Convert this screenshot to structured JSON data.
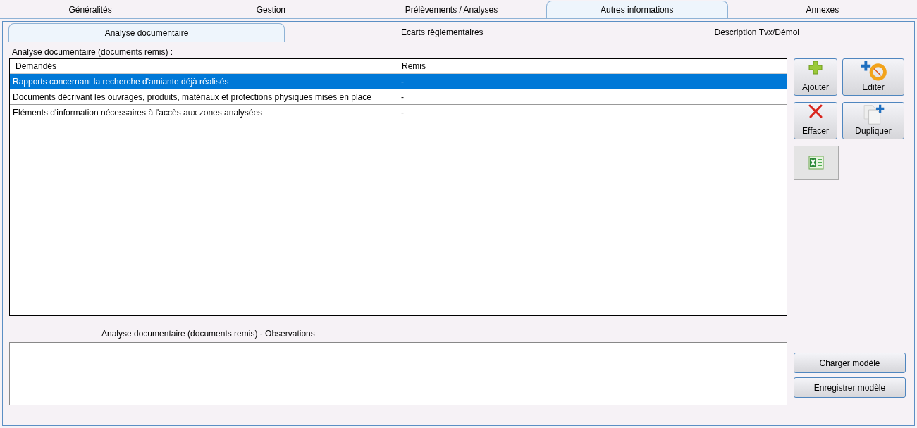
{
  "main_tabs": [
    {
      "label": "Généralités",
      "selected": false
    },
    {
      "label": "Gestion",
      "selected": false
    },
    {
      "label": "Prélèvements / Analyses",
      "selected": false
    },
    {
      "label": "Autres informations",
      "selected": true
    },
    {
      "label": "Annexes",
      "selected": false
    }
  ],
  "sub_tabs": [
    {
      "label": "Analyse documentaire",
      "selected": true
    },
    {
      "label": "Ecarts règlementaires",
      "selected": false
    },
    {
      "label": "Description Tvx/Démol",
      "selected": false
    }
  ],
  "table": {
    "title": "Analyse documentaire (documents remis) :",
    "columns": [
      "Demandés",
      "Remis"
    ],
    "rows": [
      {
        "cells": [
          "Rapports concernant la recherche d'amiante déjà réalisés",
          "-"
        ],
        "selected": true
      },
      {
        "cells": [
          "Documents décrivant les ouvrages, produits, matériaux et protections physiques mises en place",
          "-"
        ],
        "selected": false
      },
      {
        "cells": [
          "Eléments d'information nécessaires à l'accès aux zones analysées",
          "-"
        ],
        "selected": false
      }
    ]
  },
  "actions": [
    {
      "kind": "add",
      "label": "Ajouter"
    },
    {
      "kind": "edit",
      "label": "Editer"
    },
    {
      "kind": "delete",
      "label": "Effacer"
    },
    {
      "kind": "duplicate",
      "label": "Dupliquer"
    }
  ],
  "export_button": {
    "disabled": true
  },
  "observations": {
    "label": "Analyse documentaire (documents remis) - Observations"
  },
  "template_buttons": [
    "Charger modèle",
    "Enregistrer modèle"
  ]
}
